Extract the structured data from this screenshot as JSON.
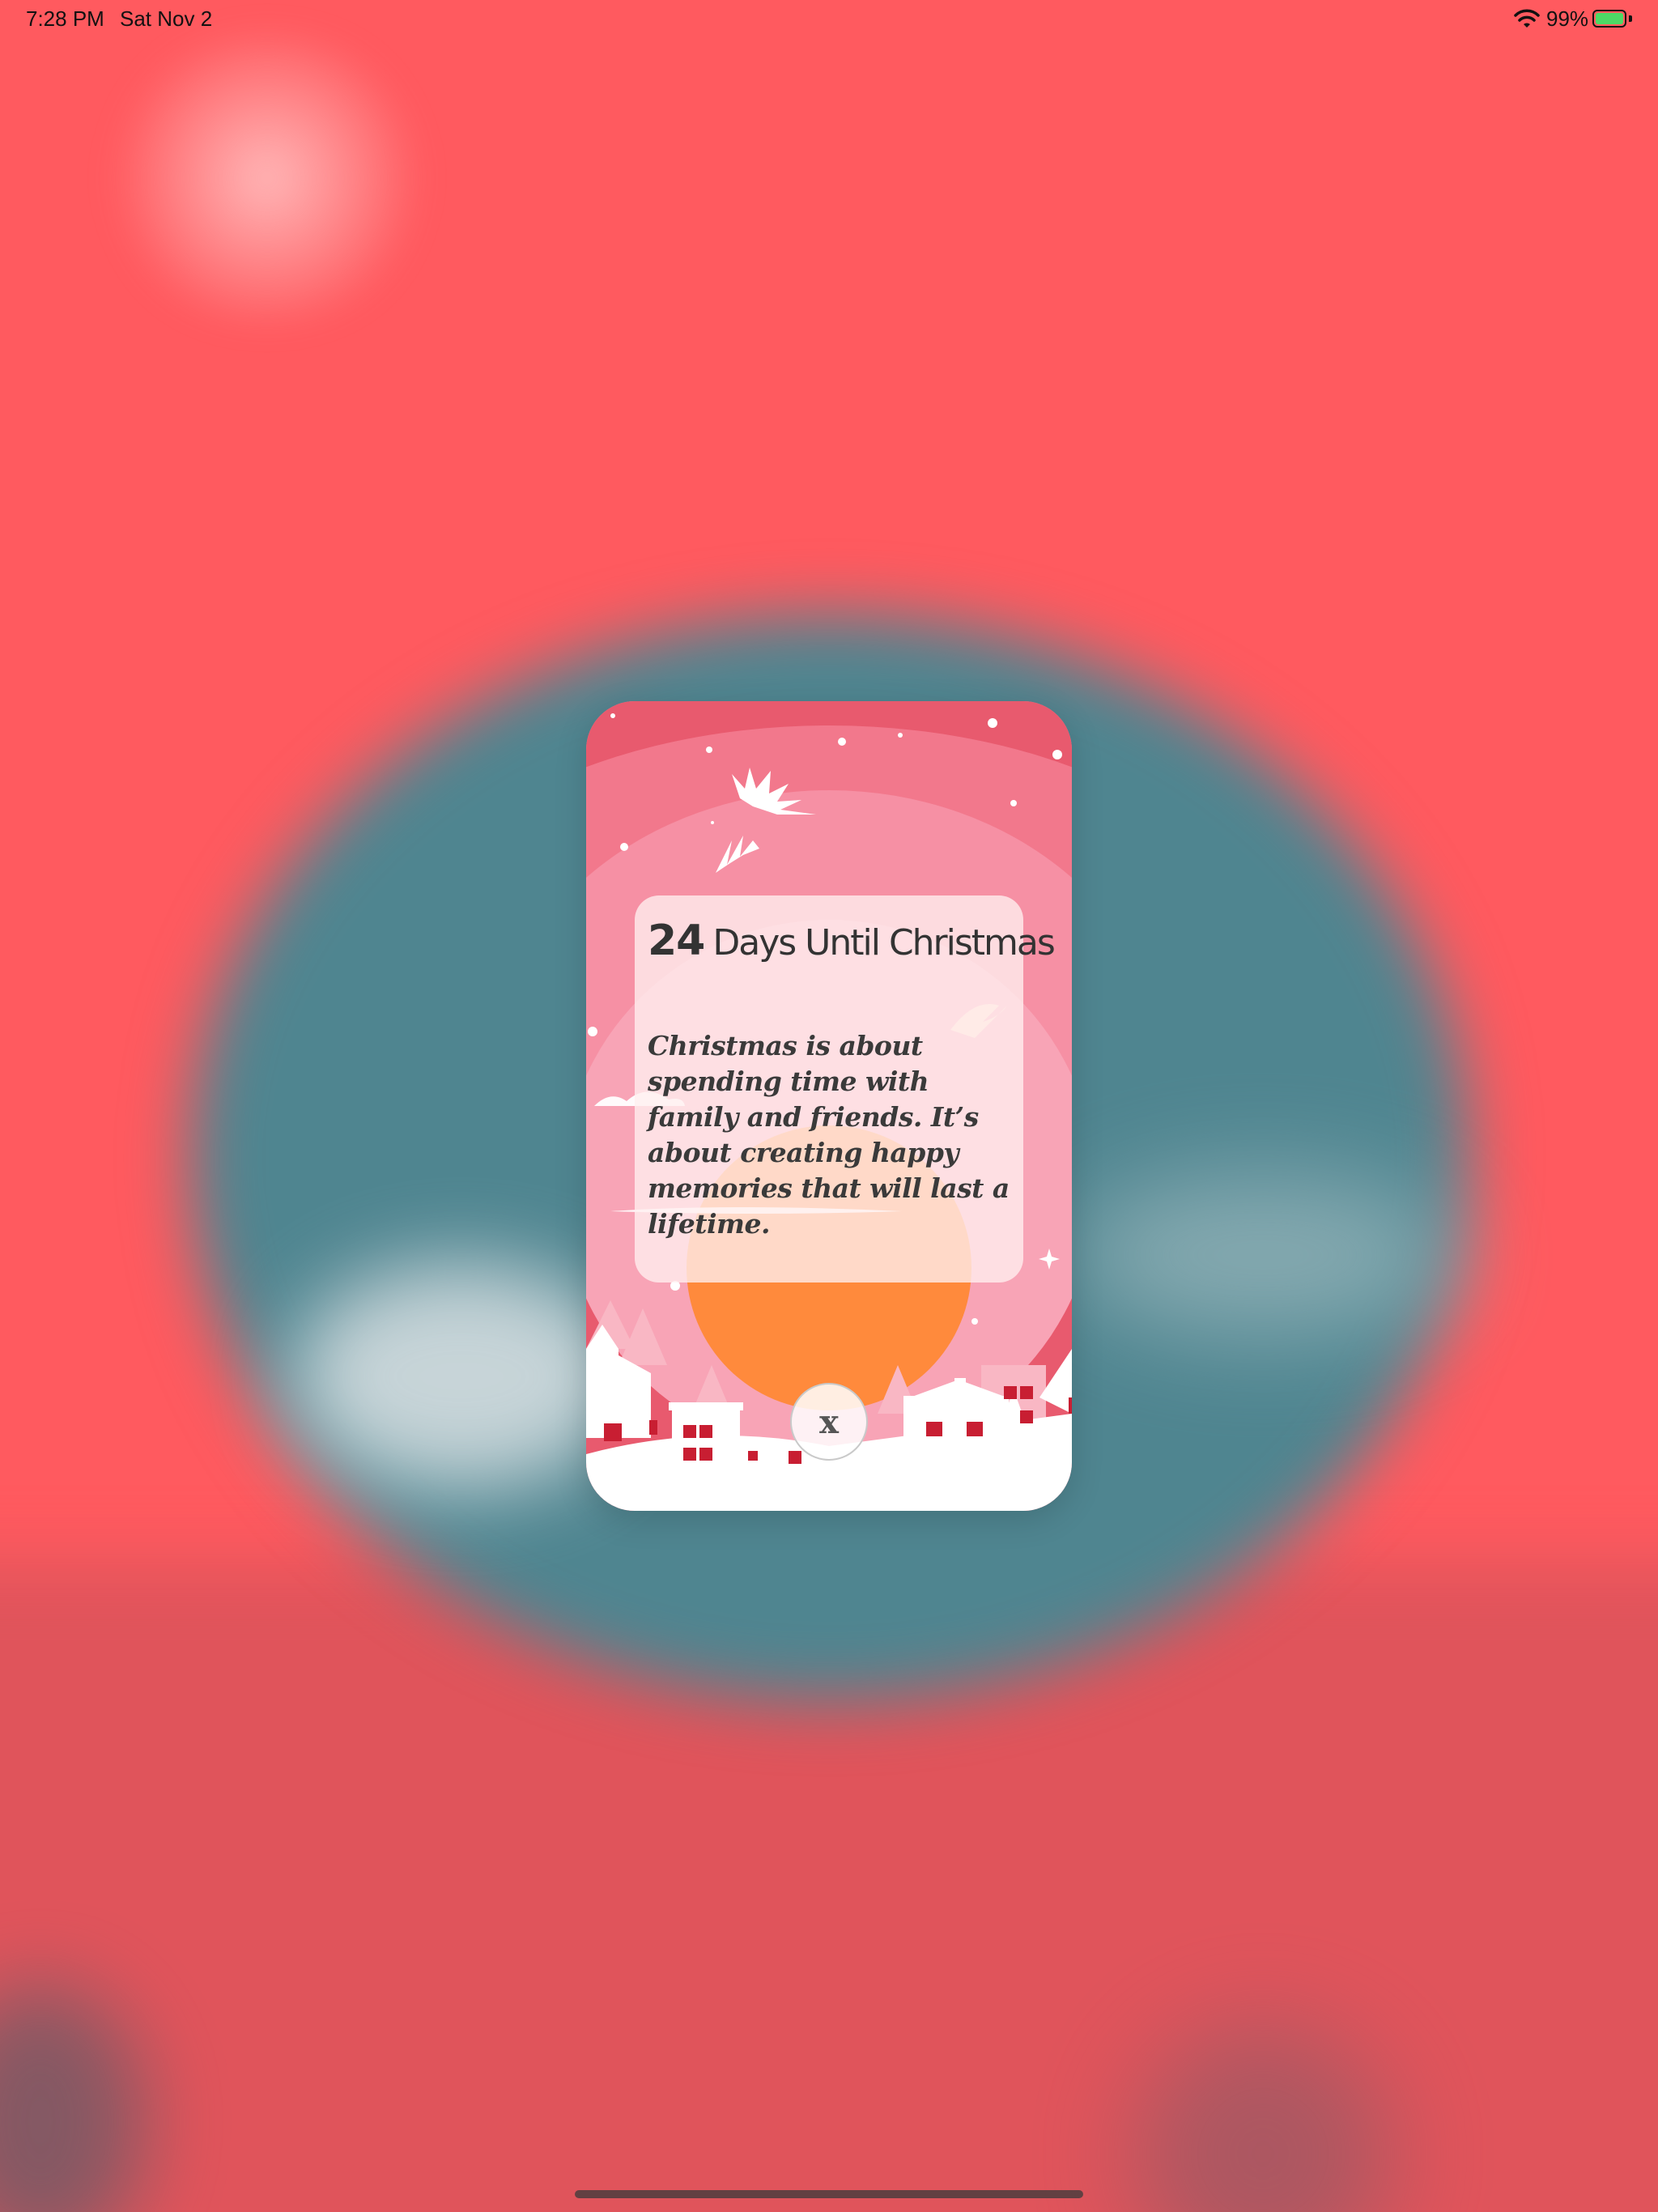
{
  "status_bar": {
    "time": "7:28 PM",
    "date": "Sat Nov 2",
    "battery_percent": "99%",
    "battery_level": 0.99,
    "icons": [
      "wifi-icon",
      "battery-charging-icon"
    ]
  },
  "card": {
    "days_count": "24",
    "days_label": "Days Until Christmas",
    "quote": "Christmas is about spending time with family and friends. It’s about creating happy memories that will last a lifetime.",
    "close_label": "x"
  },
  "colors": {
    "background": "#ff5a5f",
    "globe": "#4f8590",
    "card_sky": "#e85a6e",
    "sun": "#ff8a3c",
    "window_red": "#c81e32"
  }
}
